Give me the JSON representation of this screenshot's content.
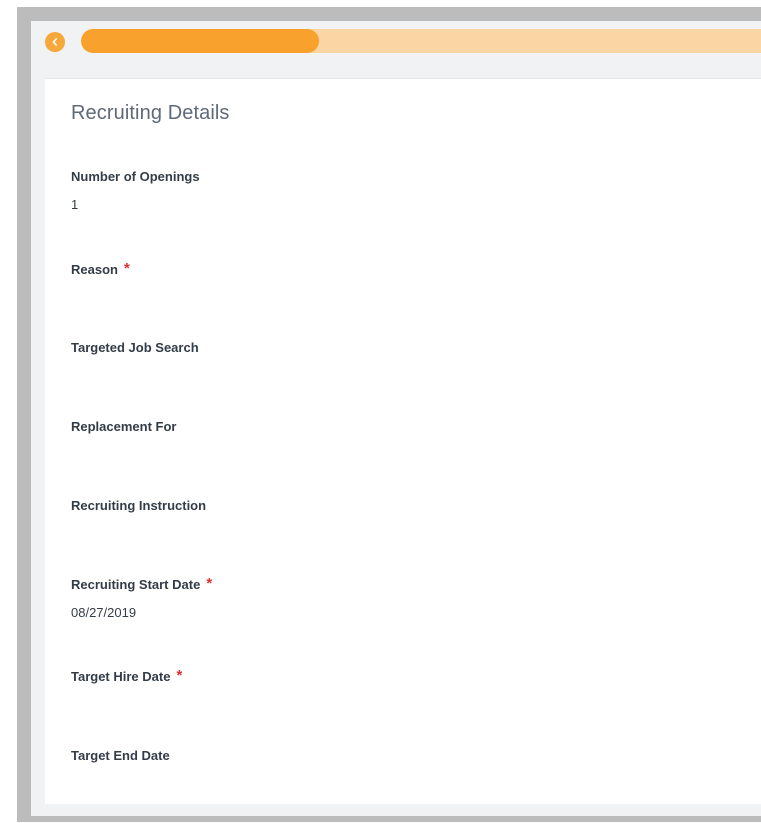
{
  "progress": {
    "fraction": 0.35
  },
  "colors": {
    "accent": "#f8a12c",
    "accent_light": "#fbd6a4",
    "required": "#de2d2d"
  },
  "icons": {
    "back": "chevron-left-icon",
    "required": "asterisk"
  },
  "section": {
    "title": "Recruiting Details"
  },
  "fields": {
    "number_of_openings": {
      "label": "Number of Openings",
      "value": "1"
    },
    "reason": {
      "label": "Reason",
      "required_mark": "*"
    },
    "targeted_job_search": {
      "label": "Targeted Job Search"
    },
    "replacement_for": {
      "label": "Replacement For"
    },
    "recruiting_instruction": {
      "label": "Recruiting Instruction"
    },
    "recruiting_start_date": {
      "label": "Recruiting Start Date",
      "required_mark": "*",
      "value": "08/27/2019"
    },
    "target_hire_date": {
      "label": "Target Hire Date",
      "required_mark": "*"
    },
    "target_end_date": {
      "label": "Target End Date"
    }
  }
}
